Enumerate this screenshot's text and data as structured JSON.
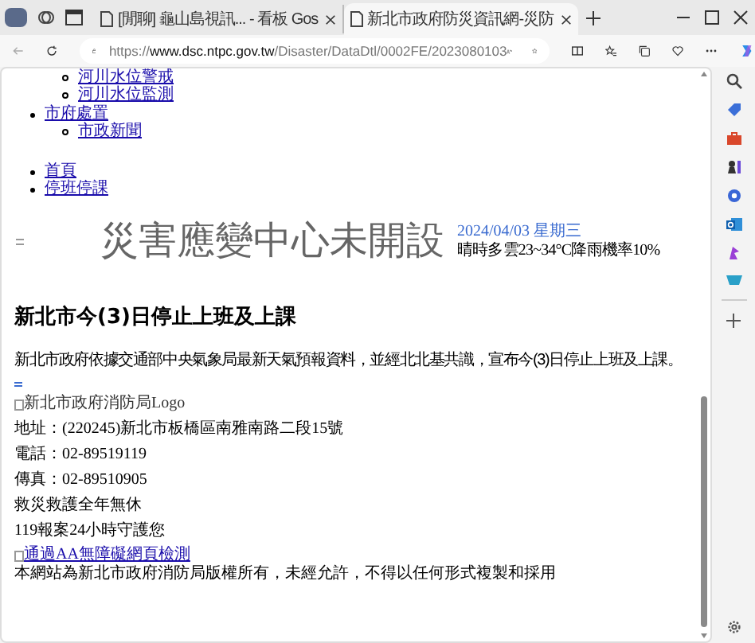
{
  "browser": {
    "tabs": [
      {
        "title": "[閒聊] 龜山島視訊... - 看板 Gos",
        "selected": false
      },
      {
        "title": "新北市政府防災資訊網-災防",
        "selected": true
      }
    ],
    "url": {
      "prefix": "https://",
      "host": "www.dsc.ntpc.gov.tw",
      "path": "/Disaster/DataDtl/0002FE/2023080103"
    }
  },
  "nav": [
    {
      "children": [
        {
          "label": "河川水位警戒"
        },
        {
          "label": "河川水位監測"
        }
      ]
    },
    {
      "label": "市府處置",
      "children": [
        {
          "label": "市政新聞"
        }
      ]
    }
  ],
  "links": [
    {
      "label": "首頁"
    },
    {
      "label": "停班停課"
    }
  ],
  "header": {
    "title": "災害應變中心未開設",
    "date": "2024/04/03 星期三",
    "weather": "晴時多雲23~34°C降雨機率10%"
  },
  "article": {
    "heading": "新北市今(3)日停止上班及上課",
    "body": "新北市政府依據交通部中央氣象局最新天氣預報資料，並經北北基共識，宣布今(3)日停止上班及上課。"
  },
  "footer": {
    "logo_alt": "新北市政府消防局Logo",
    "lines": [
      "地址：(220245)新北市板橋區南雅南路二段15號",
      "電話：02-89519119",
      "傳真：02-89510905",
      "救災救護全年無休",
      "119報案24小時守護您"
    ],
    "badge_alt": "通過AA無障礙網頁檢測",
    "copyright": "本網站為新北市政府消防局版權所有，未經允許，不得以任何形式複製和採用"
  }
}
